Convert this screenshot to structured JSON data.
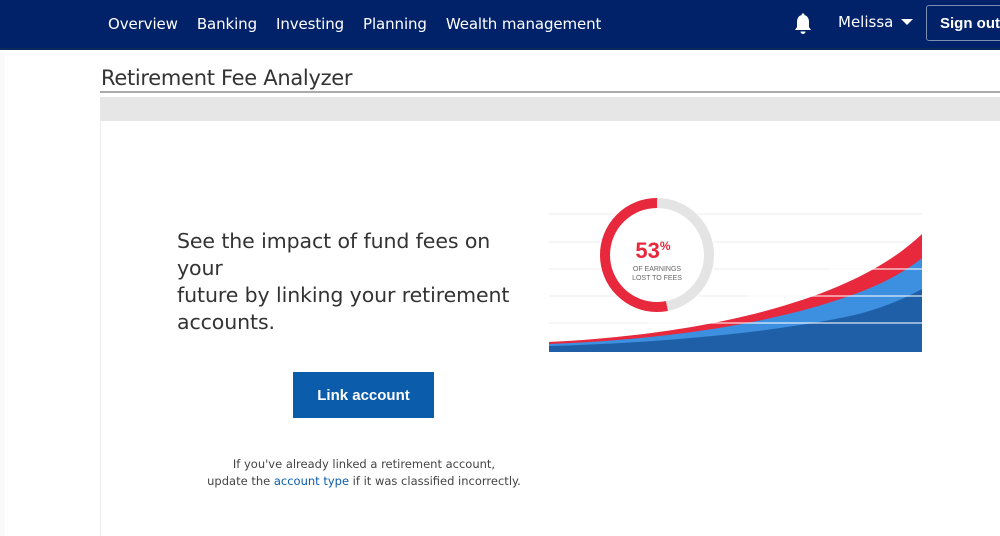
{
  "nav": {
    "links": [
      {
        "label": "Overview"
      },
      {
        "label": "Banking"
      },
      {
        "label": "Investing"
      },
      {
        "label": "Planning"
      },
      {
        "label": "Wealth management"
      }
    ],
    "notification_icon": "bell-icon",
    "user_name": "Melissa",
    "user_menu_icon": "caret-down-icon",
    "sign_out_label": "Sign out"
  },
  "page": {
    "title": "Retirement Fee Analyzer"
  },
  "promo": {
    "headline_lines": [
      "See the impact of fund fees on",
      "your",
      "future by linking your retirement",
      "accounts."
    ],
    "link_button_label": "Link account",
    "help_line1": "If you've already linked a retirement account,",
    "help_line2_prefix": "update the ",
    "help_link_label": "account type",
    "help_line2_suffix": " if it was classified incorrectly."
  },
  "illustration": {
    "donut_value": "53",
    "donut_unit": "%",
    "donut_percent": 53,
    "donut_caption_line1": "OF EARNINGS",
    "donut_caption_line2": "LOST TO FEES",
    "colors": {
      "fees_red": "#e8283c",
      "donut_track": "#e4e4e4",
      "light_blue": "#3d8fe0",
      "dark_blue": "#1f5fa8"
    }
  },
  "theme": {
    "nav_bg": "#012169",
    "button_bg": "#0b5cab",
    "link_color": "#0b5cab"
  }
}
